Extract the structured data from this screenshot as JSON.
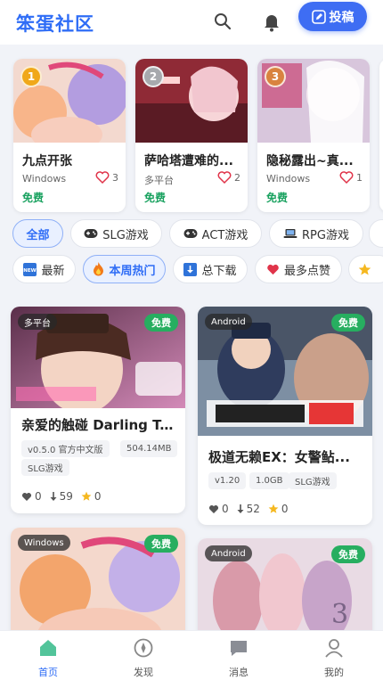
{
  "header": {
    "logo": "笨蛋社区",
    "post_label": "投稿"
  },
  "rank": [
    {
      "rank": "1",
      "title": "九点开张",
      "platform": "Windows",
      "likes": "3",
      "price": "免费",
      "badge_color": "#f0a81a"
    },
    {
      "rank": "2",
      "title": "萨哈塔遭难的...",
      "platform": "多平台",
      "likes": "2",
      "price": "免费",
      "badge_color": "#a7a9ad"
    },
    {
      "rank": "3",
      "title": "隐秘露出~真...",
      "platform": "Windows",
      "likes": "1",
      "price": "免费",
      "badge_color": "#d9833f"
    }
  ],
  "categories": [
    {
      "label": "全部",
      "icon": "",
      "active": true
    },
    {
      "label": "SLG游戏",
      "icon": "gamepad-icon"
    },
    {
      "label": "ACT游戏",
      "icon": "gamepad-icon"
    },
    {
      "label": "RPG游戏",
      "icon": "laptop-icon"
    }
  ],
  "sorts": [
    {
      "label": "最新",
      "icon": "new-icon"
    },
    {
      "label": "本周热门",
      "icon": "fire-icon",
      "active": true
    },
    {
      "label": "总下载",
      "icon": "download-icon"
    },
    {
      "label": "最多点赞",
      "icon": "heart-icon"
    }
  ],
  "games": [
    {
      "platform": "多平台",
      "free": "免费",
      "title": "亲爱的触碰 Darling To...",
      "version": "v0.5.0 官方中文版",
      "size": "504.14MB",
      "genre": "SLG游戏",
      "likes": "0",
      "downloads": "59",
      "stars": "0"
    },
    {
      "platform": "Android",
      "free": "免费",
      "title": "极道无赖EX：女警鲇...",
      "version": "v1.20",
      "size": "1.0GB",
      "genre": "SLG游戏",
      "likes": "0",
      "downloads": "52",
      "stars": "0"
    },
    {
      "platform": "Windows",
      "free": "免费"
    },
    {
      "platform": "Android",
      "free": "免费"
    }
  ],
  "nav": [
    {
      "label": "首页",
      "icon": "home-icon",
      "active": true
    },
    {
      "label": "发现",
      "icon": "compass-icon"
    },
    {
      "label": "消息",
      "icon": "message-icon"
    },
    {
      "label": "我的",
      "icon": "user-icon"
    }
  ],
  "colors": {
    "accent": "#2f6df6",
    "free": "#1aa260",
    "heart": "#e0344a"
  }
}
